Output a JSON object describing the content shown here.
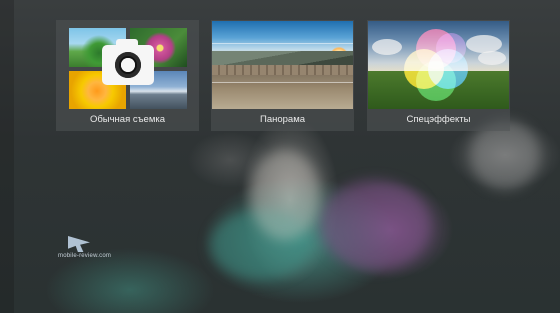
{
  "modes": [
    {
      "label": "Обычная съемка",
      "icon": "camera-icon"
    },
    {
      "label": "Панорама",
      "icon": "panorama-thumbnail"
    },
    {
      "label": "Спецэффекты",
      "icon": "effects-thumbnail"
    }
  ],
  "watermark": {
    "text": "mobile-review.com"
  },
  "colors": {
    "card_bg": "#505456",
    "label_text": "#eaeaea",
    "background": "#2b3031"
  }
}
